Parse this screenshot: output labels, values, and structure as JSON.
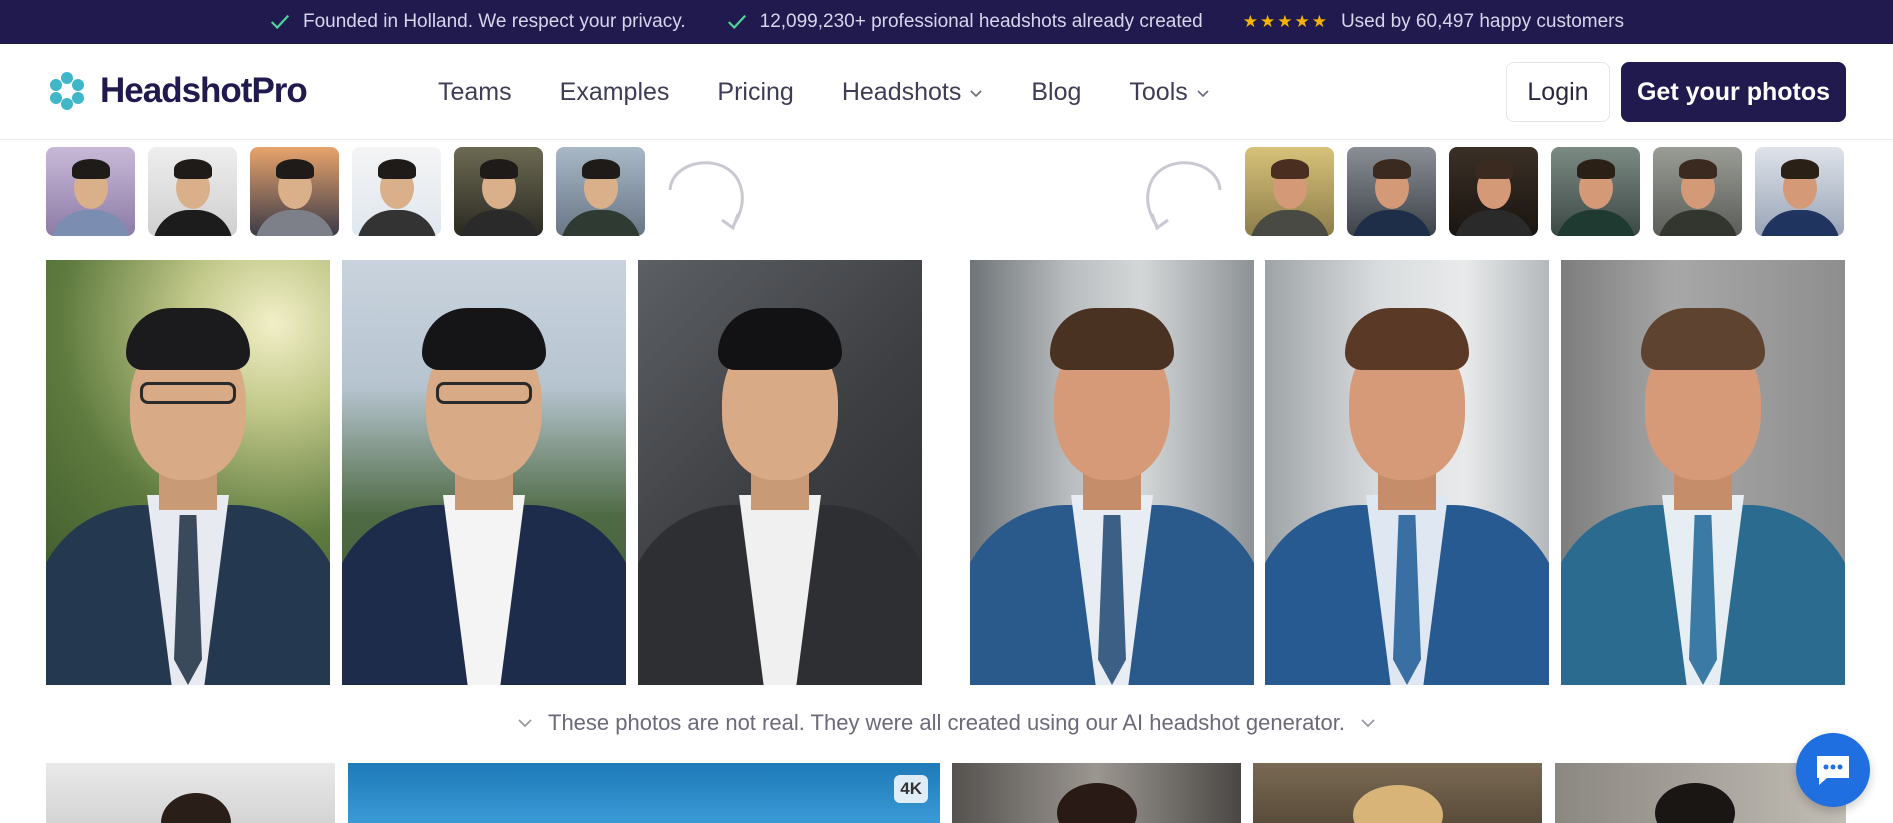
{
  "banner": {
    "items": [
      "Founded in Holland. We respect your privacy.",
      "12,099,230+ professional headshots already created",
      "Used by 60,497 happy customers"
    ],
    "rating_stars": "★★★★★"
  },
  "brand": {
    "name": "HeadshotPro",
    "accent": "#211a4f",
    "logo_color": "#3fb7c8"
  },
  "nav": {
    "items": [
      {
        "label": "Teams"
      },
      {
        "label": "Examples"
      },
      {
        "label": "Pricing"
      },
      {
        "label": "Headshots"
      },
      {
        "label": "Blog"
      },
      {
        "label": "Tools"
      }
    ],
    "login_label": "Login",
    "cta_label": "Get your photos"
  },
  "caption": "These photos are not real. They were all created using our AI headshot generator.",
  "bottom_badge": "4K",
  "icons": [
    "check-icon",
    "star-icon",
    "chevron-down-icon",
    "curved-arrow-icon",
    "chat-icon"
  ]
}
